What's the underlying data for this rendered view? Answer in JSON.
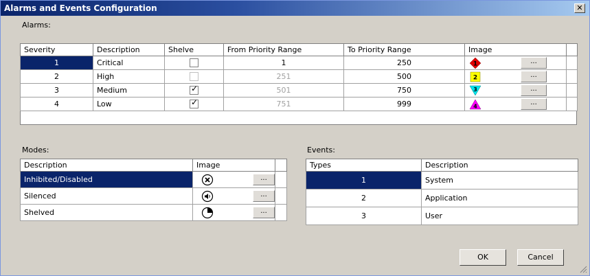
{
  "window": {
    "title": "Alarms and Events Configuration",
    "close_glyph": "✕"
  },
  "alarms": {
    "section_label": "Alarms:",
    "columns": [
      "Severity",
      "Description",
      "Shelve",
      "From Priority Range",
      "To Priority Range",
      "Image"
    ],
    "rows": [
      {
        "severity": "1",
        "description": "Critical",
        "shelve": "unchecked",
        "from": "1",
        "to": "250",
        "image": "red-diamond-1-icon",
        "image_text": "1",
        "button": "..."
      },
      {
        "severity": "2",
        "description": "High",
        "shelve": "unchecked-disabled",
        "from": "251",
        "to": "500",
        "image": "yellow-square-2-icon",
        "image_text": "2",
        "button": "..."
      },
      {
        "severity": "3",
        "description": "Medium",
        "shelve": "checked",
        "from": "501",
        "to": "750",
        "image": "cyan-down-triangle-3-icon",
        "image_text": "3",
        "button": "..."
      },
      {
        "severity": "4",
        "description": "Low",
        "shelve": "checked",
        "from": "751",
        "to": "999",
        "image": "magenta-up-triangle-4-icon",
        "image_text": "4",
        "button": "..."
      }
    ]
  },
  "modes": {
    "section_label": "Modes:",
    "columns": [
      "Description",
      "Image"
    ],
    "rows": [
      {
        "description": "Inhibited/Disabled",
        "image": "circle-x-icon",
        "button": "..."
      },
      {
        "description": "Silenced",
        "image": "circle-speaker-icon",
        "button": "..."
      },
      {
        "description": "Shelved",
        "image": "pie-quarter-icon",
        "button": "..."
      }
    ]
  },
  "events": {
    "section_label": "Events:",
    "columns": [
      "Types",
      "Description"
    ],
    "rows": [
      {
        "type": "1",
        "description": "System"
      },
      {
        "type": "2",
        "description": "Application"
      },
      {
        "type": "3",
        "description": "User"
      }
    ]
  },
  "buttons": {
    "ok": "OK",
    "cancel": "Cancel"
  },
  "colors": {
    "selection": "#0a246a",
    "dialog_bg": "#d4d0c8",
    "critical": "#e00000",
    "high": "#ffff00",
    "medium": "#00e5ee",
    "low": "#ff00ff"
  }
}
